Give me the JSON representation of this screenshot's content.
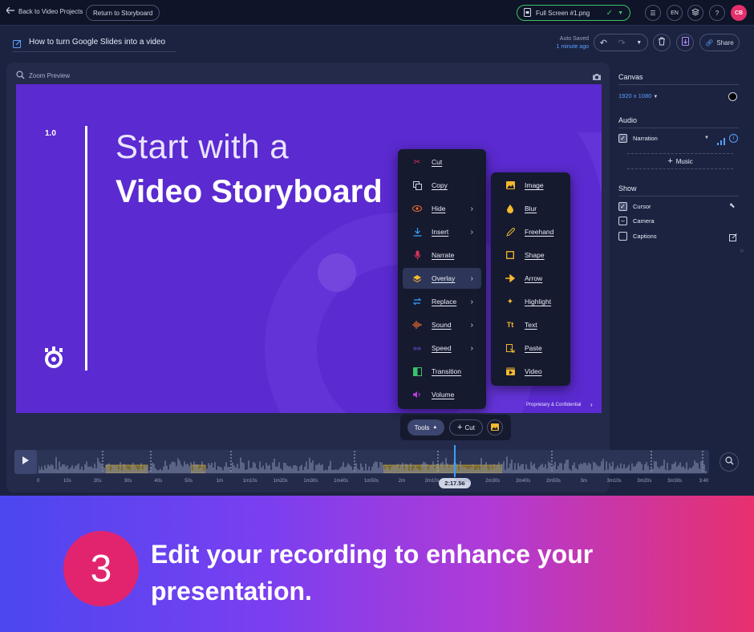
{
  "topbar": {
    "back_label": "Back to Video Projects",
    "return_label": "Return to Storyboard",
    "file_name": "Full Screen #1.png",
    "lang": "EN",
    "help": "?",
    "avatar": "CB"
  },
  "title_bar": {
    "project_title": "How to turn Google Slides into a video",
    "autosave_label": "Auto Saved",
    "autosave_time": "1 minute ago",
    "share_label": "Share"
  },
  "editor": {
    "zoom_label": "Zoom Preview"
  },
  "slide": {
    "number": "1.0",
    "line1": "Start with a",
    "line2": "Video Storyboard",
    "footer": "Proprietary & Confidential"
  },
  "menu_main": [
    {
      "label": "Cut",
      "icon": "scissors-icon",
      "color": "#e0335a",
      "arrow": false
    },
    {
      "label": "Copy",
      "icon": "copy-icon",
      "color": "#cfd4e4",
      "arrow": false
    },
    {
      "label": "Hide",
      "icon": "eye-icon",
      "color": "#f26a2e",
      "arrow": true
    },
    {
      "label": "Insert",
      "icon": "download-icon",
      "color": "#39a0ff",
      "arrow": true
    },
    {
      "label": "Narrate",
      "icon": "mic-icon",
      "color": "#e0335a",
      "arrow": false
    },
    {
      "label": "Overlay",
      "icon": "layers-icon",
      "color": "#f5b82e",
      "arrow": true
    },
    {
      "label": "Replace",
      "icon": "swap-icon",
      "color": "#39a0ff",
      "arrow": true
    },
    {
      "label": "Sound",
      "icon": "soundwave-icon",
      "color": "#f26a2e",
      "arrow": true
    },
    {
      "label": "Speed",
      "icon": "fast-forward-icon",
      "color": "#7a5cff",
      "arrow": true
    },
    {
      "label": "Transition",
      "icon": "transition-icon",
      "color": "#39c46a",
      "arrow": false
    },
    {
      "label": "Volume",
      "icon": "speaker-icon",
      "color": "#c040e0",
      "arrow": false
    }
  ],
  "menu_overlay": [
    {
      "label": "Image",
      "icon": "image-icon"
    },
    {
      "label": "Blur",
      "icon": "drop-icon"
    },
    {
      "label": "Freehand",
      "icon": "pen-icon"
    },
    {
      "label": "Shape",
      "icon": "square-icon"
    },
    {
      "label": "Arrow",
      "icon": "arrow-icon"
    },
    {
      "label": "Highlight",
      "icon": "sparkle-icon"
    },
    {
      "label": "Text",
      "icon": "text-icon"
    },
    {
      "label": "Paste",
      "icon": "paste-icon"
    },
    {
      "label": "Video",
      "icon": "video-icon"
    }
  ],
  "toolsbar": {
    "tools_label": "Tools",
    "cut_label": "Cut"
  },
  "timeline": {
    "current_time": "2:17.56",
    "ticks": [
      "0",
      "10s",
      "20s",
      "30s",
      "40s",
      "50s",
      "1m",
      "1m10s",
      "1m20s",
      "1m30s",
      "1m40s",
      "1m50s",
      "2m",
      "2m10s",
      "2m20s",
      "2m30s",
      "2m40s",
      "2m50s",
      "3m",
      "3m10s",
      "3m20s",
      "3m30s",
      "3:40"
    ]
  },
  "panel": {
    "canvas_title": "Canvas",
    "resolution": "1920 x 1080",
    "audio_title": "Audio",
    "narration": "Narration",
    "music": "Music",
    "show_title": "Show",
    "cursor": "Cursor",
    "camera": "Camera",
    "captions": "Captions"
  },
  "banner": {
    "step": "3",
    "text": "Edit your recording to enhance your presentation."
  },
  "colors": {
    "accent": "#5b2ad0",
    "success": "#39c46a",
    "link": "#5aa0ff",
    "banner_circle": "#e2246e"
  }
}
